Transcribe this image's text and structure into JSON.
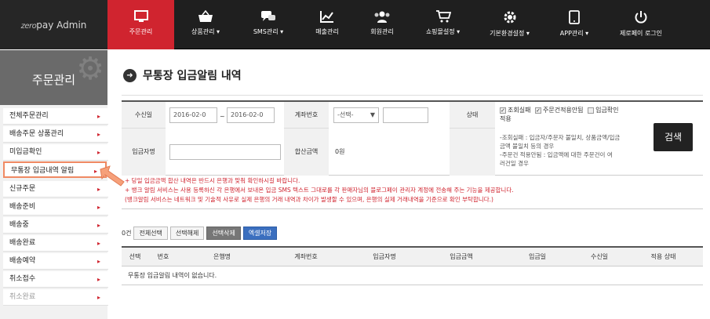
{
  "logo": {
    "text_a": "zero",
    "text_b": "pay",
    "text_c": " Admin"
  },
  "nav": [
    {
      "label": "주문관리",
      "icon": "monitor-icon",
      "active": true
    },
    {
      "label": "상품관리 ▾",
      "icon": "basket-icon"
    },
    {
      "label": "SMS관리 ▾",
      "icon": "chat-icon"
    },
    {
      "label": "매출관리",
      "icon": "chart-icon"
    },
    {
      "label": "회원관리",
      "icon": "users-icon"
    },
    {
      "label": "쇼핑몰설정 ▾",
      "icon": "cart-icon"
    },
    {
      "label": "기본환경설정 ▾",
      "icon": "gear-icon"
    },
    {
      "label": "APP관리 ▾",
      "icon": "phone-icon"
    },
    {
      "label": "제로페이 로그인",
      "icon": "power-icon"
    }
  ],
  "sidebar": {
    "title": "주문관리",
    "items": [
      {
        "label": "전체주문관리"
      },
      {
        "label": "배송주문 상품관리"
      },
      {
        "label": "미입금확인"
      },
      {
        "label": "무통장 입금내역 알림"
      },
      {
        "label": "신규주문"
      },
      {
        "label": "배송준비"
      },
      {
        "label": "배송중"
      },
      {
        "label": "배송완료"
      },
      {
        "label": "배송예약"
      },
      {
        "label": "취소접수"
      },
      {
        "label": "취소완료"
      }
    ]
  },
  "page": {
    "title": "무통장 입금알림 내역"
  },
  "form": {
    "date_label": "수신일",
    "date_from": "2016-02-0",
    "date_sep": "~",
    "date_to": "2016-02-0",
    "account_label": "계좌번호",
    "account_select": "-선택-",
    "status_label": "상태",
    "status_opt1": "조회실패",
    "status_opt2": "주문건적용안됨",
    "status_opt3": "입금확인",
    "status_opt3b": "적용",
    "payer_label": "입금자명",
    "sum_label": "합산금액",
    "sum_value": "0원",
    "desc1": "-조회실패 : 입금자/주문자 불일치, 상품금액/입금",
    "desc2": "금액 불일치 등의 경우",
    "desc3": "-주문건 적용안됨 : 입금액에 대한 주문건이 여",
    "desc4": "러건일 경우",
    "search_btn": "검색"
  },
  "notice": {
    "line1": "+ 당일 입금금액 합산 내역은 반드시 은행과 맞춰 확인하시길 바랍니다.",
    "line2": "+ 뱅크 알림 서비스는 사용 등록하신 각 은행에서 보내온 입금 SMS 텍스트 그대로를 각 판매자님의 블로그페이 관리자 계정에 전송해 주는 기능을 제공합니다.",
    "line3": "(뱅크알림 서비스는 네트워크 및 기술적 사유로 실제 은행의 거래 내역과 차이가 발생할 수 있으며, 은행의 실제 거래내역을 기준으로 확인 부탁합니다.)"
  },
  "actions": {
    "count": "0건",
    "select_all": "전체선택",
    "deselect": "선택해제",
    "delete": "선택삭제",
    "excel": "엑셀저장"
  },
  "table": {
    "headers": [
      "선택",
      "번호",
      "은행명",
      "계좌번호",
      "입금자명",
      "입금금액",
      "입금일",
      "수신일",
      "적용 상태"
    ],
    "empty": "무통장 입금알림 내역이 없습니다."
  },
  "colors": {
    "accent": "#d0242f",
    "nav_bg": "#1f1f1f",
    "highlight": "#f08a63"
  }
}
